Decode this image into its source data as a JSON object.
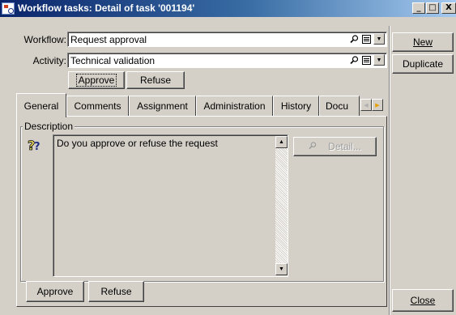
{
  "window": {
    "title": "Workflow tasks: Detail of task '001194'",
    "controls": {
      "minimize": "_",
      "maximize": "□",
      "close": "X"
    }
  },
  "form": {
    "workflow": {
      "label": "Workflow:",
      "value": "Request approval"
    },
    "activity": {
      "label": "Activity:",
      "value": "Technical validation"
    },
    "approve_label": "Approve",
    "refuse_label": "Refuse"
  },
  "side_buttons": {
    "new_label": "New",
    "duplicate_label": "Duplicate",
    "close_label": "Close"
  },
  "tabs": {
    "items": [
      {
        "label": "General"
      },
      {
        "label": "Comments"
      },
      {
        "label": "Assignment"
      },
      {
        "label": "Administration"
      },
      {
        "label": "History"
      },
      {
        "label": "Docu"
      }
    ],
    "active": "General"
  },
  "general_tab": {
    "group_title": "Description",
    "description_text": "Do you approve or refuse the request",
    "detail_label": "Detail...",
    "approve_label": "Approve",
    "refuse_label": "Refuse"
  },
  "icons": {
    "window": "app-icon",
    "lookup": "magnifier-icon",
    "list": "list-icon",
    "dropdown": "dropdown-arrow-icon",
    "question": "question-icon",
    "scroll_up": "scroll-up-arrow",
    "scroll_down": "scroll-down-arrow",
    "tab_left": "tab-scroll-left-arrow",
    "tab_right": "tab-scroll-right-arrow"
  },
  "colors": {
    "titlebar_start": "#0a246a",
    "titlebar_end": "#a6caf0",
    "face": "#d4d0c8",
    "tab_right_arrow": "#e8a000"
  }
}
